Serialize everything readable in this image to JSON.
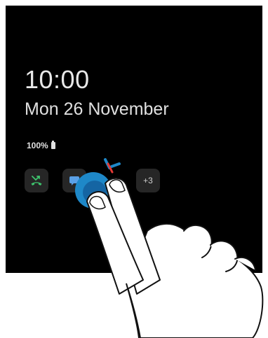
{
  "lock_screen": {
    "time": "10:00",
    "date": "Mon 26 November",
    "battery_level": "100%"
  },
  "notifications": {
    "more_count": "+3"
  },
  "icons": {
    "missed_call": "missed-call-icon",
    "message": "message-icon",
    "battery": "battery-icon"
  },
  "colors": {
    "screen_background": "#000000",
    "missed_call_icon": "#3ec46d",
    "tap_indicator": "#1e88c8",
    "notification_badge_bg": "#262626"
  }
}
